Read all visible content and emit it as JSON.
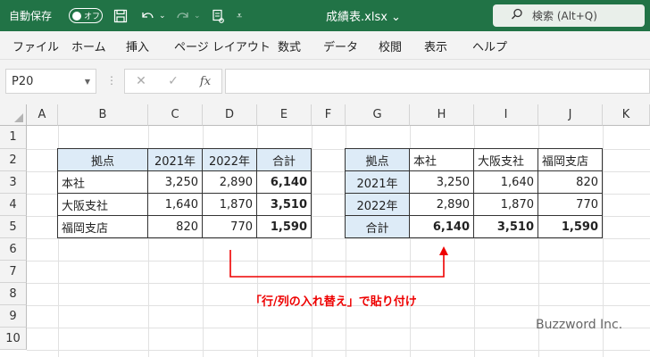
{
  "titlebar": {
    "autosave_label": "自動保存",
    "autosave_state": "オフ",
    "filename": "成績表.xlsx ⌄",
    "search_text": "検索 (Alt+Q)",
    "icons": [
      "save-icon",
      "undo-icon",
      "redo-icon",
      "format-painter-icon",
      "customize-qat-icon",
      "search-icon"
    ]
  },
  "menu": {
    "items": [
      "ファイル",
      "ホーム",
      "挿入",
      "ページ レイアウト",
      "数式",
      "データ",
      "校閲",
      "表示",
      "ヘルプ"
    ]
  },
  "formula_bar": {
    "name_box": "P20",
    "formula": ""
  },
  "sheet": {
    "columns": [
      "A",
      "B",
      "C",
      "D",
      "E",
      "F",
      "G",
      "H",
      "I",
      "J",
      "K"
    ],
    "rows": [
      "1",
      "2",
      "3",
      "4",
      "5",
      "6",
      "7",
      "8",
      "9",
      "10"
    ],
    "table1": {
      "header": [
        "拠点",
        "2021年",
        "2022年",
        "合計"
      ],
      "rows": [
        [
          "本社",
          "3,250",
          "2,890",
          "6,140"
        ],
        [
          "大阪支社",
          "1,640",
          "1,870",
          "3,510"
        ],
        [
          "福岡支店",
          "820",
          "770",
          "1,590"
        ]
      ]
    },
    "table2": {
      "header": [
        "拠点",
        "本社",
        "大阪支社",
        "福岡支店"
      ],
      "rows": [
        [
          "2021年",
          "3,250",
          "1,640",
          "820"
        ],
        [
          "2022年",
          "2,890",
          "1,870",
          "770"
        ],
        [
          "合計",
          "6,140",
          "3,510",
          "1,590"
        ]
      ]
    }
  },
  "annotation": {
    "text": "「行/列の入れ替え」で貼り付け",
    "color": "#e00000"
  },
  "watermark": "Buzzword Inc.",
  "colors": {
    "titlebar": "#217346",
    "header_fill": "#ddebf7",
    "annotation": "#e00000"
  }
}
